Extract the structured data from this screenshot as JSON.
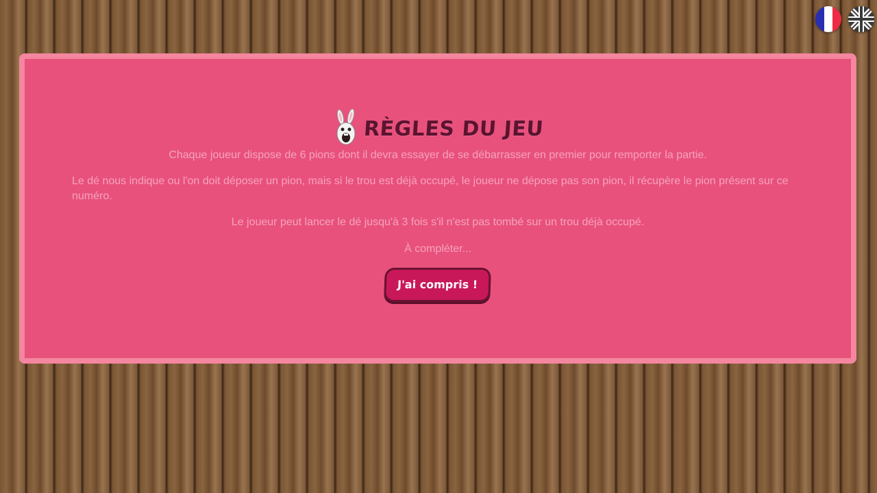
{
  "languages": [
    {
      "code": "fr",
      "icon": "france-flag-icon"
    },
    {
      "code": "en",
      "icon": "uk-flag-icon"
    }
  ],
  "rules_panel": {
    "title": "Règles du jeu",
    "title_icon": "rabbid-icon",
    "paragraphs": [
      "Chaque joueur dispose de 6 pions dont il devra essayer de se débarrasser en premier pour remporter la partie.",
      "Le dé nous indique ou l'on doit déposer un pion, mais si le trou est déjà occupé, le joueur ne dépose pas son pion, il récupère le pion présent sur ce numéro.",
      "Le joueur peut lancer le dé jusqu'à 3 fois s'il n'est pas tombé sur un trou déjà occupé.",
      "À compléter..."
    ],
    "button_label": "J'ai compris !"
  },
  "colors": {
    "panel_bg": "#e8517c",
    "panel_border": "#f4869f",
    "title": "#5a1430",
    "text": "#f6a3bd",
    "button_bg": "#c8185a",
    "button_border": "#6b1231"
  }
}
